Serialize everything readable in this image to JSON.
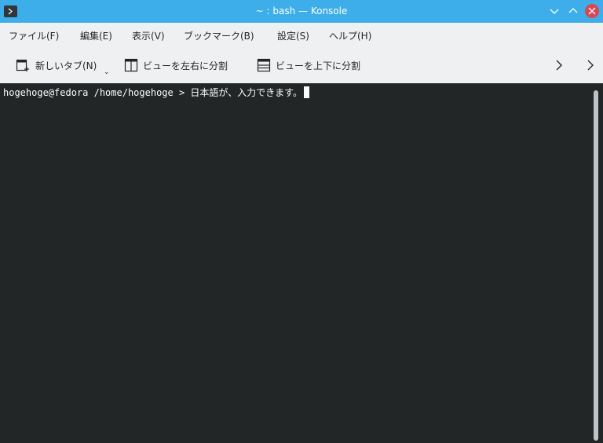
{
  "window": {
    "title": "~ : bash — Konsole",
    "app_icon": "konsole-icon",
    "controls": [
      "minimize-icon",
      "maximize-icon",
      "close-icon"
    ],
    "accent_color": "#3daee9",
    "close_color": "#da4453"
  },
  "menubar": {
    "items": [
      {
        "label": "ファイル(F)"
      },
      {
        "label": "編集(E)"
      },
      {
        "label": "表示(V)"
      },
      {
        "label": "ブックマーク(B)"
      },
      {
        "label": "設定(S)"
      },
      {
        "label": "ヘルプ(H)"
      }
    ]
  },
  "toolbar": {
    "new_tab_label": "新しいタブ(N)",
    "split_lr_label": "ビューを左右に分割",
    "split_tb_label": "ビューを上下に分割",
    "overflow_icons": [
      "chevron-right-icon",
      "chevron-right-icon"
    ]
  },
  "terminal": {
    "prompt": "hogehoge@fedora /home/hogehoge > ",
    "input": "日本語が、入力できます。",
    "background": "#232627",
    "foreground": "#fcfcfc"
  }
}
